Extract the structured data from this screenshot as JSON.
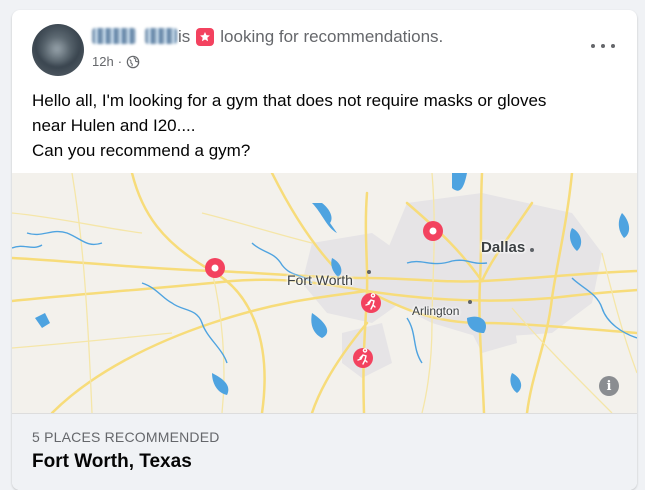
{
  "post": {
    "author_name_1": "",
    "author_name_2": "",
    "is_text": "is",
    "status_text": "looking for recommendations.",
    "timestamp": "12h",
    "separator": "·",
    "body_lines": [
      "Hello all, I'm looking for a gym that does not require masks or gloves",
      "near Hulen and I20....",
      "Can you recommend a gym?"
    ]
  },
  "map": {
    "labels": {
      "dallas": "Dallas",
      "fort_worth": "Fort Worth",
      "arlington": "Arlington"
    },
    "info_glyph": "i",
    "pins": [
      {
        "type": "place-pin",
        "color": "#f3425f"
      },
      {
        "type": "place-pin",
        "color": "#f3425f"
      },
      {
        "type": "gym-pin",
        "color": "#f3425f"
      },
      {
        "type": "gym-pin",
        "color": "#f3425f"
      }
    ]
  },
  "recommendations": {
    "count_label": "5 PLACES RECOMMENDED",
    "location": "Fort Worth, Texas"
  },
  "colors": {
    "accent": "#f3425f",
    "muted_text": "#65676b",
    "water": "#4ea3e0",
    "roads": "#f7dc7a",
    "urban": "#e6e4e6"
  },
  "icons": {
    "status": "star-badge-icon",
    "privacy": "globe-icon",
    "menu": "more-options-icon",
    "info": "info-icon"
  }
}
